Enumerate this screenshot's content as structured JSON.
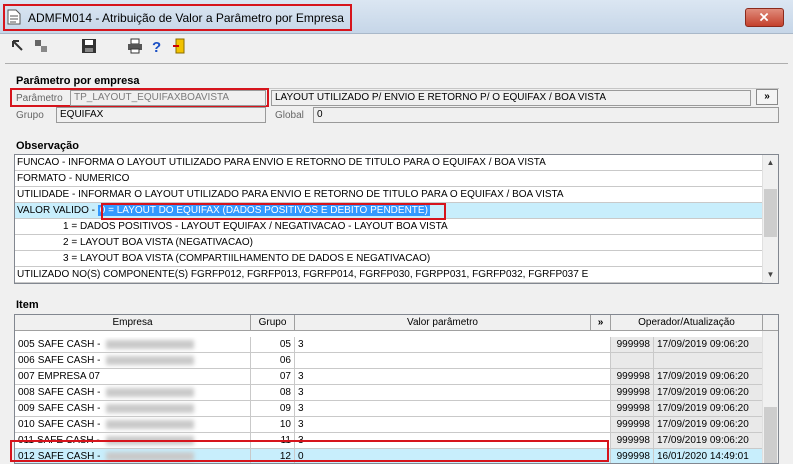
{
  "window": {
    "title": "ADMFM014 - Atribuição de Valor a Parâmetro por Empresa"
  },
  "parametro": {
    "section_title": "Parâmetro por empresa",
    "param_label": "Parâmetro",
    "param_value": "TP_LAYOUT_EQUIFAXBOAVISTA",
    "param_desc": "LAYOUT UTILIZADO P/ ENVIO E RETORNO P/ O EQUIFAX / BOA VISTA",
    "more_label": "»",
    "grupo_label": "Grupo",
    "grupo_value": "EQUIFAX",
    "global_label": "Global",
    "global_value": "0"
  },
  "observacao": {
    "section_title": "Observação",
    "lines": [
      "FUNCAO - INFORMA O LAYOUT UTILIZADO PARA ENVIO E RETORNO DE TITULO PARA O EQUIFAX / BOA VISTA",
      "FORMATO - NUMERICO",
      "UTILIDADE - INFORMAR O LAYOUT UTILIZADO PARA ENVIO E RETORNO DE TITULO PARA O EQUIFAX / BOA VISTA",
      "1 = DADOS POSITIVOS - LAYOUT EQUIFAX  / NEGATIVACAO - LAYOUT BOA VISTA",
      "2 = LAYOUT BOA VISTA (NEGATIVACAO)",
      "3 = LAYOUT BOA VISTA (COMPARTIILHAMENTO DE DADOS E NEGATIVACAO)",
      "UTILIZADO NO(S) COMPONENTE(S) FGRFP012, FGRFP013, FGRFP014, FGRFP030, FGRPP031, FGRFP032, FGRFP037 E"
    ],
    "valor_prefix": "VALOR VALIDO -",
    "valor_highlight": "0 = LAYOUT DO EQUIFAX (DADOS POSITIVOS E DEBITO PENDENTE)"
  },
  "item": {
    "section_title": "Item",
    "columns": [
      "Empresa",
      "Grupo",
      "Valor parâmetro",
      "»",
      "Operador/Atualização"
    ],
    "rows": [
      {
        "code": "005",
        "name": "SAFE CASH -",
        "grupo": "05",
        "valor": "3",
        "op": "999998",
        "dt": "17/09/2019 09:06:20"
      },
      {
        "code": "006",
        "name": "SAFE CASH -",
        "grupo": "06",
        "valor": "",
        "op": "",
        "dt": ""
      },
      {
        "code": "007",
        "name": "EMPRESA 07",
        "grupo": "07",
        "valor": "3",
        "op": "999998",
        "dt": "17/09/2019 09:06:20"
      },
      {
        "code": "008",
        "name": "SAFE CASH -",
        "grupo": "08",
        "valor": "3",
        "op": "999998",
        "dt": "17/09/2019 09:06:20"
      },
      {
        "code": "009",
        "name": "SAFE CASH -",
        "grupo": "09",
        "valor": "3",
        "op": "999998",
        "dt": "17/09/2019 09:06:20"
      },
      {
        "code": "010",
        "name": "SAFE CASH -",
        "grupo": "10",
        "valor": "3",
        "op": "999998",
        "dt": "17/09/2019 09:06:20"
      },
      {
        "code": "011",
        "name": "SAFE CASH -",
        "grupo": "11",
        "valor": "3",
        "op": "999998",
        "dt": "17/09/2019 09:06:20"
      },
      {
        "code": "012",
        "name": "SAFE CASH -",
        "grupo": "12",
        "valor": "0",
        "op": "999998",
        "dt": "16/01/2020 14:49:01"
      }
    ]
  },
  "icons": [
    "doc-icon",
    "arrow-icon",
    "grid-icon",
    "save-icon",
    "print-icon",
    "help-icon",
    "exit-icon"
  ],
  "colors": {
    "highlight": "#d6141c",
    "selection": "#c8eefc",
    "accent": "#3399ff"
  }
}
